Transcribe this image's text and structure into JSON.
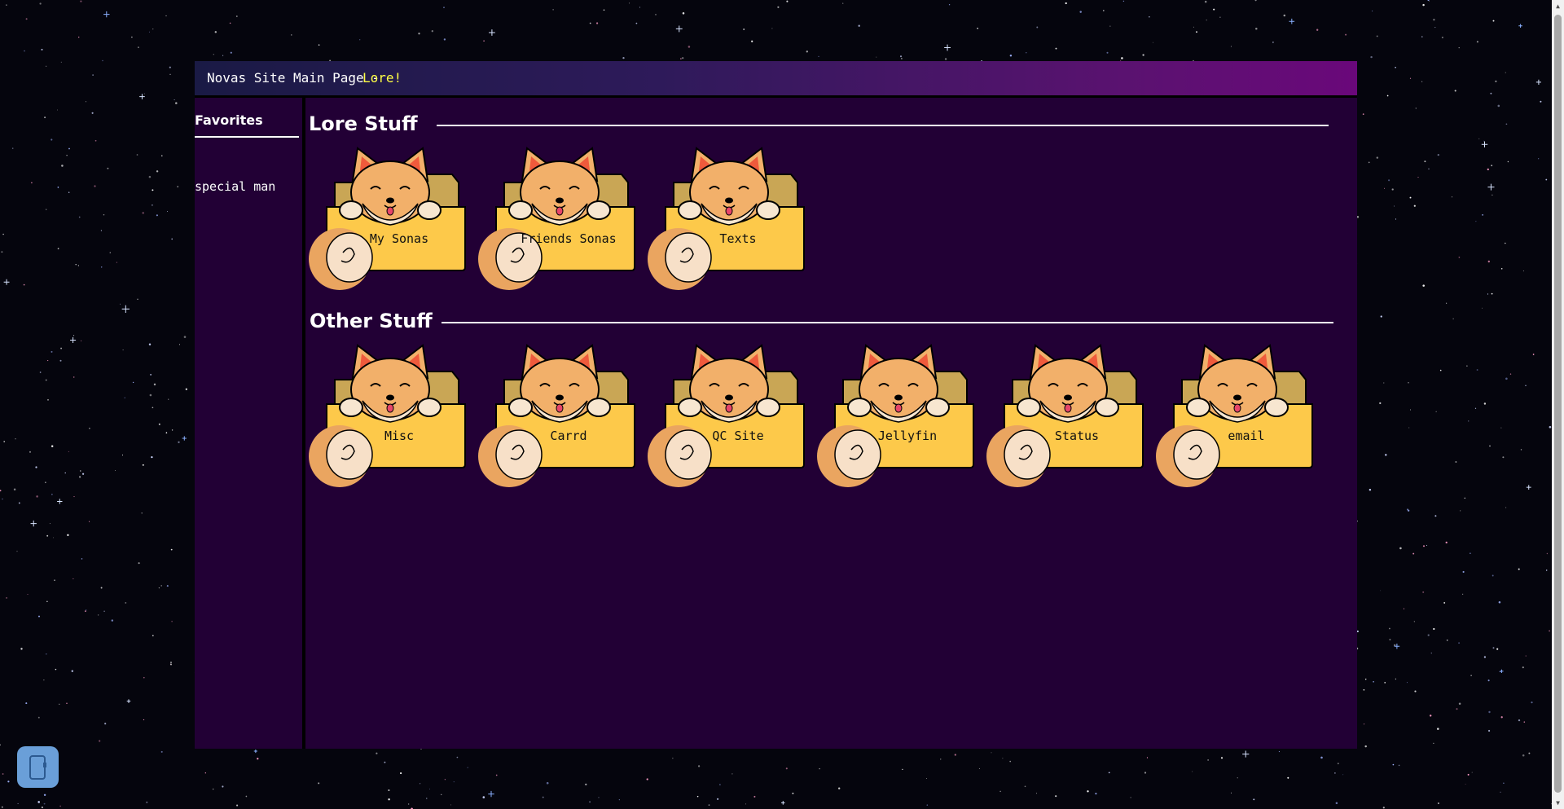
{
  "page": {
    "background_color": "#05050d",
    "panel_color": "#220035",
    "accent_color": "#ffff44"
  },
  "titlebar": {
    "site_title": "Novas Site Main Page -",
    "current_page": "Lore!"
  },
  "sidebar": {
    "heading": "Favorites",
    "links": [
      {
        "label": "special man"
      }
    ]
  },
  "sections": [
    {
      "title": "Lore Stuff",
      "folders": [
        {
          "label": "My Sonas"
        },
        {
          "label": "Friends Sonas"
        },
        {
          "label": "Texts"
        }
      ]
    },
    {
      "title": "Other Stuff",
      "folders": [
        {
          "label": "Misc"
        },
        {
          "label": "Carrd"
        },
        {
          "label": "QC Site"
        },
        {
          "label": "Jellyfin"
        },
        {
          "label": "Status"
        },
        {
          "label": "email"
        }
      ]
    }
  ],
  "icons": {
    "folder": "corgi-folder-icon",
    "device": "phone-icon"
  }
}
